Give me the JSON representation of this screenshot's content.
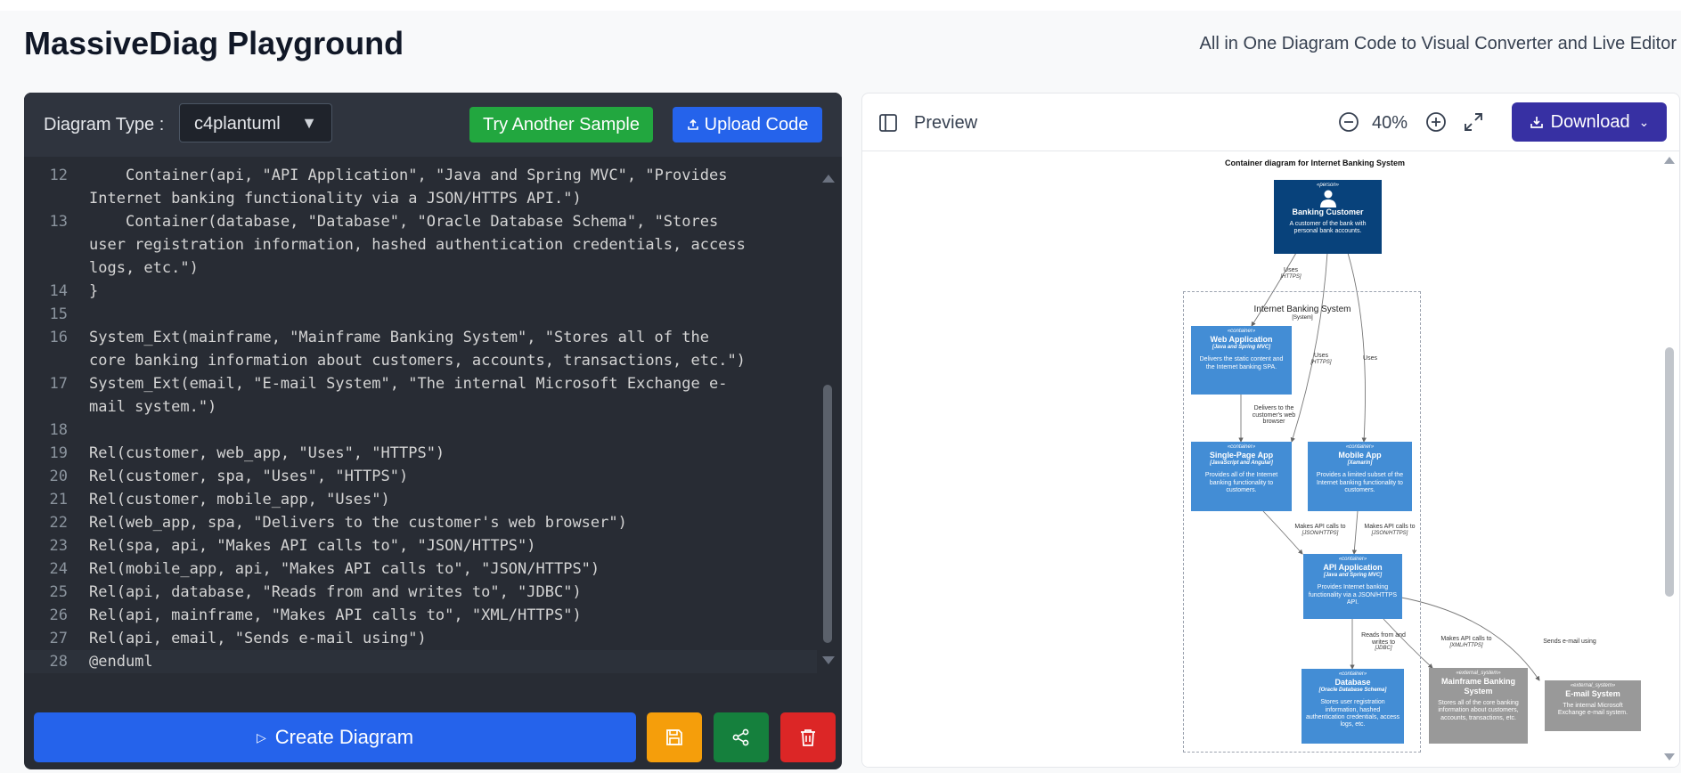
{
  "header": {
    "title": "MassiveDiag Playground",
    "tagline": "All in One Diagram Code to Visual Converter and Live Editor"
  },
  "editor": {
    "diagram_type_label": "Diagram Type :",
    "diagram_type_value": "c4plantuml",
    "try_sample_label": "Try Another Sample",
    "upload_label": "Upload Code",
    "lines": [
      {
        "no": "12",
        "code": "    Container(api, \"API Application\", \"Java and Spring MVC\", \"Provides Internet banking functionality via a JSON/HTTPS API.\")"
      },
      {
        "no": "13",
        "code": "    Container(database, \"Database\", \"Oracle Database Schema\", \"Stores user registration information, hashed authentication credentials, access logs, etc.\")"
      },
      {
        "no": "14",
        "code": "}"
      },
      {
        "no": "15",
        "code": ""
      },
      {
        "no": "16",
        "code": "System_Ext(mainframe, \"Mainframe Banking System\", \"Stores all of the core banking information about customers, accounts, transactions, etc.\")"
      },
      {
        "no": "17",
        "code": "System_Ext(email, \"E-mail System\", \"The internal Microsoft Exchange e-mail system.\")"
      },
      {
        "no": "18",
        "code": ""
      },
      {
        "no": "19",
        "code": "Rel(customer, web_app, \"Uses\", \"HTTPS\")"
      },
      {
        "no": "20",
        "code": "Rel(customer, spa, \"Uses\", \"HTTPS\")"
      },
      {
        "no": "21",
        "code": "Rel(customer, mobile_app, \"Uses\")"
      },
      {
        "no": "22",
        "code": "Rel(web_app, spa, \"Delivers to the customer's web browser\")"
      },
      {
        "no": "23",
        "code": "Rel(spa, api, \"Makes API calls to\", \"JSON/HTTPS\")"
      },
      {
        "no": "24",
        "code": "Rel(mobile_app, api, \"Makes API calls to\", \"JSON/HTTPS\")"
      },
      {
        "no": "25",
        "code": "Rel(api, database, \"Reads from and writes to\", \"JDBC\")"
      },
      {
        "no": "26",
        "code": "Rel(api, mainframe, \"Makes API calls to\", \"XML/HTTPS\")"
      },
      {
        "no": "27",
        "code": "Rel(api, email, \"Sends e-mail using\")"
      },
      {
        "no": "28",
        "code": "@enduml"
      }
    ],
    "create_label": "Create Diagram"
  },
  "preview": {
    "title": "Preview",
    "zoom": "40%",
    "download_label": "Download"
  },
  "diagram": {
    "title": "Container diagram for Internet Banking System",
    "boundary_name": "Internet Banking System",
    "boundary_type": "[System]",
    "customer": {
      "stereo": "«person»",
      "name": "Banking Customer",
      "desc": "A customer of the bank with personal bank accounts."
    },
    "web_app": {
      "stereo": "«container»",
      "name": "Web Application",
      "tech": "[Java and Spring MVC]",
      "desc": "Delivers the static content and the Internet banking SPA."
    },
    "spa": {
      "stereo": "«container»",
      "name": "Single-Page App",
      "tech": "[JavaScript and Angular]",
      "desc": "Provides all of the Internet banking functionality to customers."
    },
    "mobile_app": {
      "stereo": "«container»",
      "name": "Mobile App",
      "tech": "[Xamarin]",
      "desc": "Provides a limited subset of the Internet banking functionality to customers."
    },
    "api": {
      "stereo": "«container»",
      "name": "API Application",
      "tech": "[Java and Spring MVC]",
      "desc": "Provides Internet banking functionality via a JSON/HTTPS API."
    },
    "database": {
      "stereo": "«container»",
      "name": "Database",
      "tech": "[Oracle Database Schema]",
      "desc": "Stores user registration information, hashed authentication credentials, access logs, etc."
    },
    "mainframe": {
      "stereo": "«external_system»",
      "name": "Mainframe Banking System",
      "desc": "Stores all of the core banking information about customers, accounts, transactions, etc."
    },
    "email": {
      "stereo": "«external_system»",
      "name": "E-mail System",
      "desc": "The internal Microsoft Exchange e-mail system."
    },
    "rels": {
      "uses": "Uses",
      "https": "[HTTPS]",
      "delivers": "Delivers to the customer's web browser",
      "makes_api": "Makes API calls to",
      "json_https": "[JSON/HTTPS]",
      "reads_writes": "Reads from and writes to",
      "jdbc": "[JDBC]",
      "xml_https": "[XML/HTTPS]",
      "sends_email": "Sends e-mail using"
    }
  },
  "colors": {
    "editor_bg": "#282c34",
    "primary": "#2563eb",
    "success": "#22a73f",
    "save": "#f59e0b",
    "share": "#15803d",
    "delete": "#dc2626",
    "download": "#3730a3",
    "c4_person": "#08427b",
    "c4_container": "#438dd5",
    "c4_external": "#999999"
  }
}
